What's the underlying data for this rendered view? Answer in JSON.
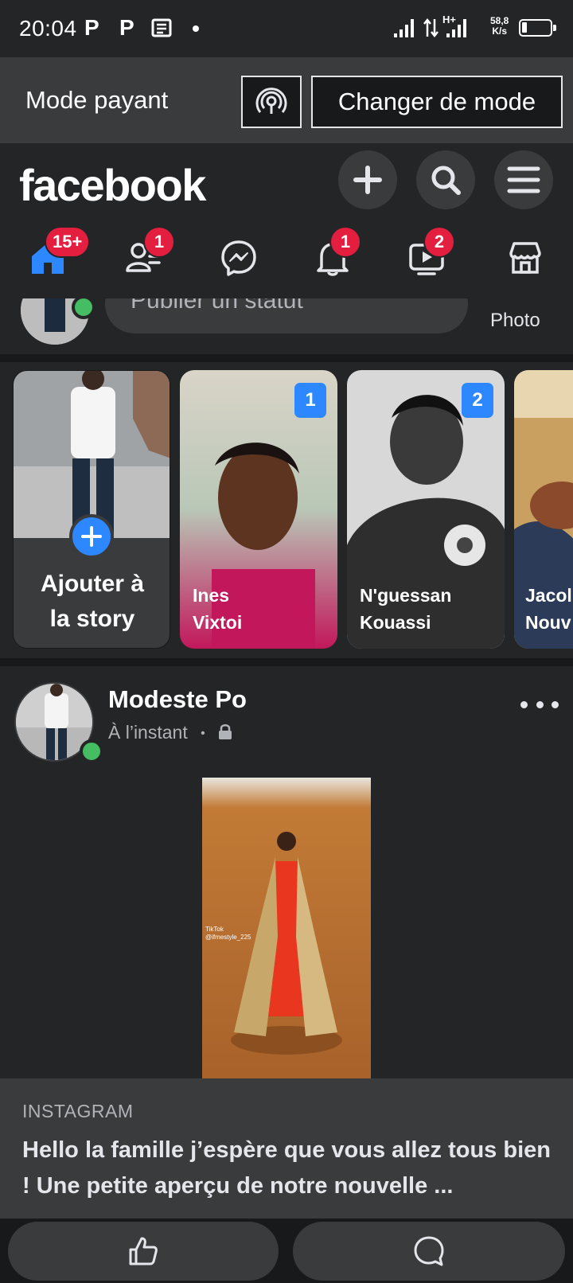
{
  "status_bar": {
    "time": "20:04",
    "network_type": "H+",
    "speed_value": "58,8",
    "speed_unit": "K/s"
  },
  "mode_bar": {
    "label": "Mode payant",
    "change_button": "Changer de mode"
  },
  "header": {
    "logo": "facebook"
  },
  "tabs": [
    {
      "name": "home",
      "badge": "15+"
    },
    {
      "name": "friends",
      "badge": "1"
    },
    {
      "name": "messenger",
      "badge": ""
    },
    {
      "name": "notifications",
      "badge": "1"
    },
    {
      "name": "watch",
      "badge": "2"
    },
    {
      "name": "marketplace",
      "badge": ""
    }
  ],
  "composer": {
    "placeholder": "Publier un statut",
    "photo_label": "Photo"
  },
  "stories": {
    "add_label_line1": "Ajouter à",
    "add_label_line2": "la story",
    "items": [
      {
        "name_line1": "Ines",
        "name_line2": "Vixtoi",
        "count": "1"
      },
      {
        "name_line1": "N'guessan",
        "name_line2": "Kouassi",
        "count": "2"
      },
      {
        "name_line1": "Jacol",
        "name_line2": "Nouv",
        "count": ""
      }
    ]
  },
  "post": {
    "author": "Modeste Po",
    "time": "À l’instant",
    "separator": "•",
    "image_watermark_1": "TikTok",
    "image_watermark_2": "@ifmestyle_225",
    "link_source": "INSTAGRAM",
    "link_title": "Hello la famille j’espère que vous allez tous bien ! Une petite aperçu de notre nouvelle ..."
  },
  "colors": {
    "accent_blue": "#2d88ff",
    "badge_red": "#e41e3f",
    "online_green": "#45bd62"
  }
}
